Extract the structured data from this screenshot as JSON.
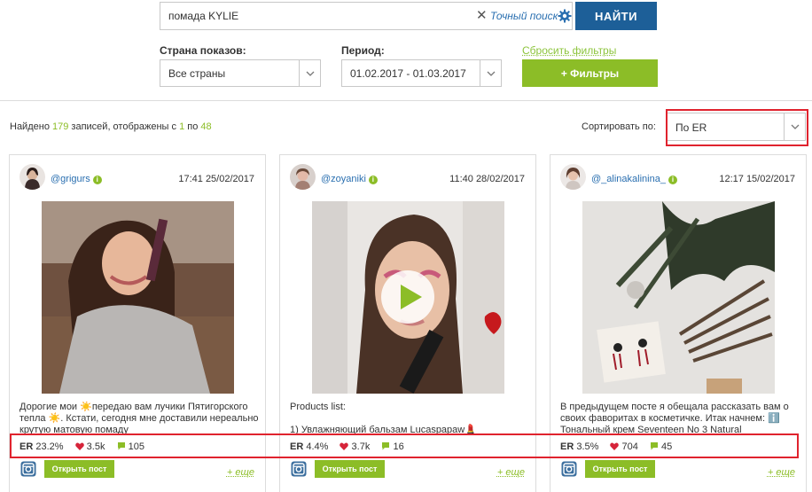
{
  "search": {
    "value": "помада KYLIE",
    "clear_symbol": "✕",
    "exact_label": "Точный поиск",
    "submit_label": "НАЙТИ"
  },
  "filters": {
    "country_label": "Страна показов:",
    "country_value": "Все страны",
    "period_label": "Период:",
    "period_value": "01.02.2017 - 01.03.2017",
    "reset_label": "Сбросить фильтры",
    "filters_button": "+ Фильтры"
  },
  "results": {
    "found_prefix": "Найдено",
    "total": "179",
    "middle": "записей, отображены с",
    "from": "1",
    "to_word": "по",
    "to": "48",
    "sort_label": "Сортировать по:",
    "sort_value": "По ER"
  },
  "colors": {
    "accent_green": "#8cbd27",
    "button_blue": "#1d5f98",
    "link_blue": "#2a6fb0",
    "highlight_red": "#e0232e",
    "like_red": "#d6243a"
  },
  "cards": [
    {
      "username": "@grigurs",
      "datetime": "17:41 25/02/2017",
      "description": "Дорогие мои ☀️передаю вам лучики Пятигорского тепла ☀️. Кстати, сегодня мне доставили нереально крутую матовую помаду",
      "er_label": "ER",
      "er": "23.2%",
      "likes": "3.5k",
      "comments": "105",
      "open_label": "Открыть пост",
      "more_label": "+ еще",
      "has_video": false
    },
    {
      "username": "@zoyaniki",
      "datetime": "11:40 28/02/2017",
      "description": "Products list:\n\n1) Увлажняющий бальзам Lucaspapaw💄",
      "er_label": "ER",
      "er": "4.4%",
      "likes": "3.7k",
      "comments": "16",
      "open_label": "Открыть пост",
      "more_label": "+ еще",
      "has_video": true
    },
    {
      "username": "@_alinakalinina_",
      "datetime": "12:17 15/02/2017",
      "description": "В предыдущем посте я обещала рассказать вам о своих фаворитах в косметичке. Итак начнем: ℹ️ Тональный крем Seventeen No 3 Natural",
      "er_label": "ER",
      "er": "3.5%",
      "likes": "704",
      "comments": "45",
      "open_label": "Открыть пост",
      "more_label": "+ еще",
      "has_video": false
    }
  ]
}
